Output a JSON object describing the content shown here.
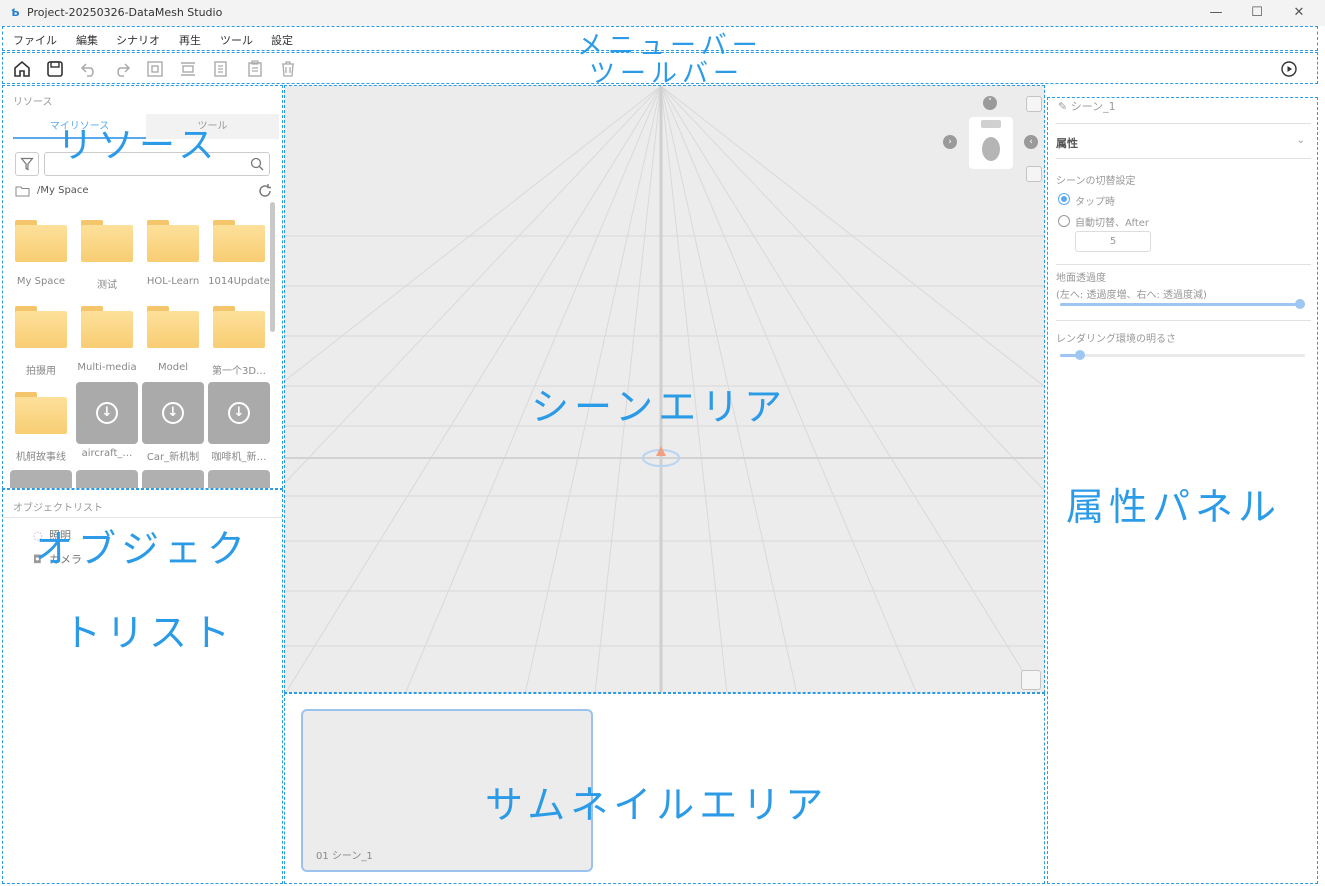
{
  "window": {
    "title": "Project-20250326-DataMesh Studio",
    "logo_text": "Ƅ",
    "controls": [
      "—",
      "☐",
      "✕"
    ]
  },
  "menubar": {
    "items": [
      "ファイル",
      "編集",
      "シナリオ",
      "再生",
      "ツール",
      "設定"
    ],
    "annotation": "メニューバー"
  },
  "toolbar": {
    "annotation": "ツールバー",
    "icons": [
      "home-icon",
      "save-icon",
      "undo-icon",
      "redo-icon",
      "fit-icon",
      "align-icon",
      "copy-icon",
      "paste-icon",
      "delete-icon",
      "play-icon"
    ]
  },
  "resources": {
    "header": "リソース",
    "tabs": [
      "マイリソース",
      "ツール"
    ],
    "search_placeholder": "",
    "path": "/My Space",
    "annotation": "リソース",
    "items": [
      {
        "label": "My Space",
        "type": "folder"
      },
      {
        "label": "测试",
        "type": "folder"
      },
      {
        "label": "HOL-Learn",
        "type": "folder"
      },
      {
        "label": "1014Update",
        "type": "folder"
      },
      {
        "label": "拍摄用",
        "type": "folder"
      },
      {
        "label": "Multi-media",
        "type": "folder"
      },
      {
        "label": "Model",
        "type": "folder"
      },
      {
        "label": "第一个3D…",
        "type": "folder"
      },
      {
        "label": "机舸故事线",
        "type": "folder"
      },
      {
        "label": "aircraft_…",
        "type": "model"
      },
      {
        "label": "Car_新机制",
        "type": "model"
      },
      {
        "label": "咖啡机_新…",
        "type": "model"
      }
    ]
  },
  "object_list": {
    "header": "オブジェクトリスト",
    "items": [
      "照明",
      "カメラ"
    ],
    "annotation_line1": "オブジェク",
    "annotation_line2": "トリスト"
  },
  "scene_area": {
    "annotation": "シーンエリア"
  },
  "thumbnail_area": {
    "annotation": "サムネイルエリア",
    "thumbs": [
      {
        "caption": "01 シーン_1"
      }
    ]
  },
  "properties": {
    "scene_name": "シーン_1",
    "section_title": "属性",
    "transition_label": "シーンの切替設定",
    "radio_tap": "タップ時",
    "radio_auto": "自動切替、After",
    "auto_seconds": "5",
    "ground_label": "地面透過度",
    "ground_hint": "(左へ: 透過度増、右へ: 透過度減)",
    "ground_value": 1.0,
    "brightness_label": "レンダリング環境の明るさ",
    "brightness_value": 0.08,
    "annotation": "属性パネル"
  }
}
